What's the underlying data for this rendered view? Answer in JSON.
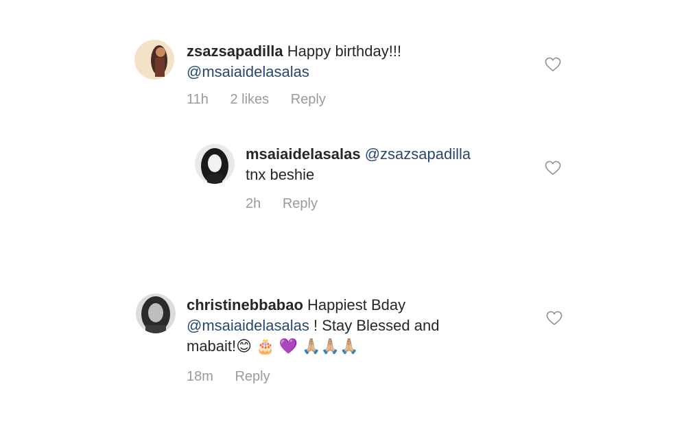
{
  "comments": [
    {
      "username": "zsazsapadilla",
      "text_before": "Happy birthday!!!",
      "mention": "@msaiaidelasalas",
      "time": "11h",
      "likes": "2 likes",
      "reply": "Reply"
    },
    {
      "username": "msaiaidelasalas",
      "mention": "@zsazsapadilla",
      "text_after": "tnx beshie",
      "time": "2h",
      "reply": "Reply"
    },
    {
      "username": "christinebbabao",
      "text_before": "Happiest Bday",
      "mention": "@msaiaidelasalas",
      "text_after": "! Stay Blessed and",
      "text_line3": "mabait!",
      "emojis": "😊 🎂 💜 🙏🏼🙏🏼🙏🏼",
      "time": "18m",
      "reply": "Reply"
    }
  ],
  "icons": {
    "like": "heart-outline-icon"
  },
  "colors": {
    "mention": "#27476f",
    "meta": "#9a9a9a",
    "text": "#262626"
  }
}
